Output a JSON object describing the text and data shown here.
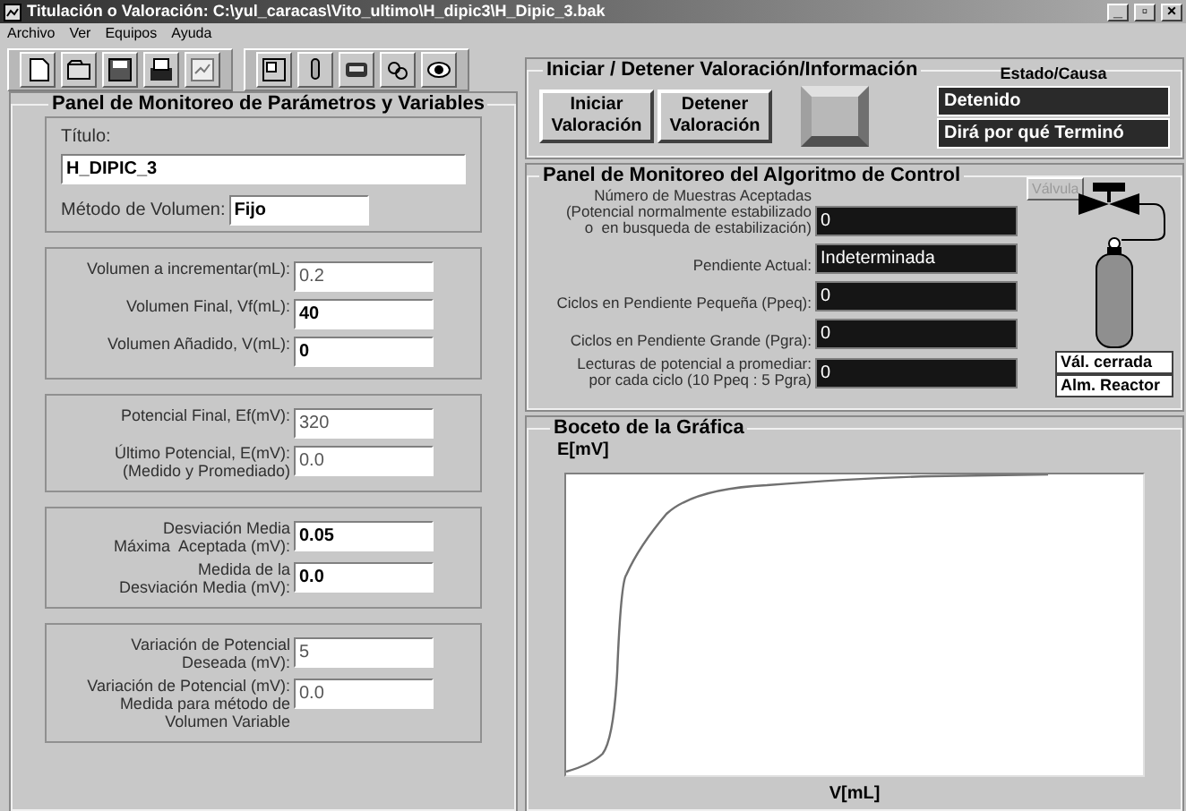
{
  "window": {
    "title": "Titulación o Valoración: C:\\yul_caracas\\Vito_ultimo\\H_dipic3\\H_Dipic_3.bak",
    "controls": [
      "_",
      "▫",
      "×"
    ]
  },
  "menu": [
    "Archivo",
    "Ver",
    "Equipos",
    "Ayuda"
  ],
  "parameters_panel": {
    "title": "Panel de Monitoreo de Parámetros y Variables",
    "titulo": {
      "label": "Título:",
      "value": "H_DIPIC_3"
    },
    "metodo": {
      "label": "Método de Volumen:",
      "value": "Fijo"
    },
    "groups": [
      [
        {
          "label": "Volumen a incrementar(mL):",
          "value": "0.2",
          "disabled": true
        },
        {
          "label": "Volumen Final, Vf(mL):",
          "value": "40",
          "disabled": false
        },
        {
          "label": "Volumen Añadido, V(mL):",
          "value": "0",
          "disabled": false
        }
      ],
      [
        {
          "label": "Potencial Final, Ef(mV):",
          "value": "320",
          "disabled": true
        },
        {
          "label": "Último Potencial, E(mV):\n(Medido y Promediado)",
          "value": "0.0",
          "disabled": true
        }
      ],
      [
        {
          "label": "Desviación Media\nMáxima  Aceptada (mV):",
          "value": "0.05",
          "disabled": false
        },
        {
          "label": "Medida de la\nDesviación Media (mV):",
          "value": "0.0",
          "disabled": false
        }
      ],
      [
        {
          "label": "Variación de Potencial\nDeseada (mV):",
          "value": "5",
          "disabled": true
        },
        {
          "label": "Variación de Potencial (mV):\nMedida para método de\nVolumen Variable",
          "value": "0.0",
          "disabled": true
        }
      ]
    ]
  },
  "start_stop": {
    "title": "Iniciar / Detener Valoración/Información",
    "buttons": [
      "Iniciar\nValoración",
      "Detener\nValoración"
    ],
    "status_label": "Estado/Causa",
    "status": [
      "Detenido",
      "Dirá por qué Terminó"
    ]
  },
  "control_panel": {
    "title": "Panel de Monitoreo del Algoritmo de Control",
    "valve_button": {
      "label": "Válvula",
      "disabled": true
    },
    "rows": [
      {
        "label": "Número de Muestras Aceptadas\n(Potencial normalmente estabilizado\no  en busqueda de estabilización)",
        "value": "0"
      },
      {
        "label": "Pendiente Actual:",
        "value": "Indeterminada"
      },
      {
        "label": "Ciclos en Pendiente Pequeña (Ppeq):",
        "value": "0"
      },
      {
        "label": "Ciclos en Pendiente Grande (Pgra):",
        "value": "0"
      },
      {
        "label": "Lecturas de potencial a promediar:\npor cada ciclo (10 Ppeq : 5 Pgra)",
        "value": "0"
      }
    ],
    "valve_labels": [
      "Vál. cerrada",
      "Alm. Reactor"
    ]
  },
  "chart_panel": {
    "title": "Boceto de la Gráfica",
    "ylabel": "E[mV]",
    "xlabel": "V[mL]"
  }
}
